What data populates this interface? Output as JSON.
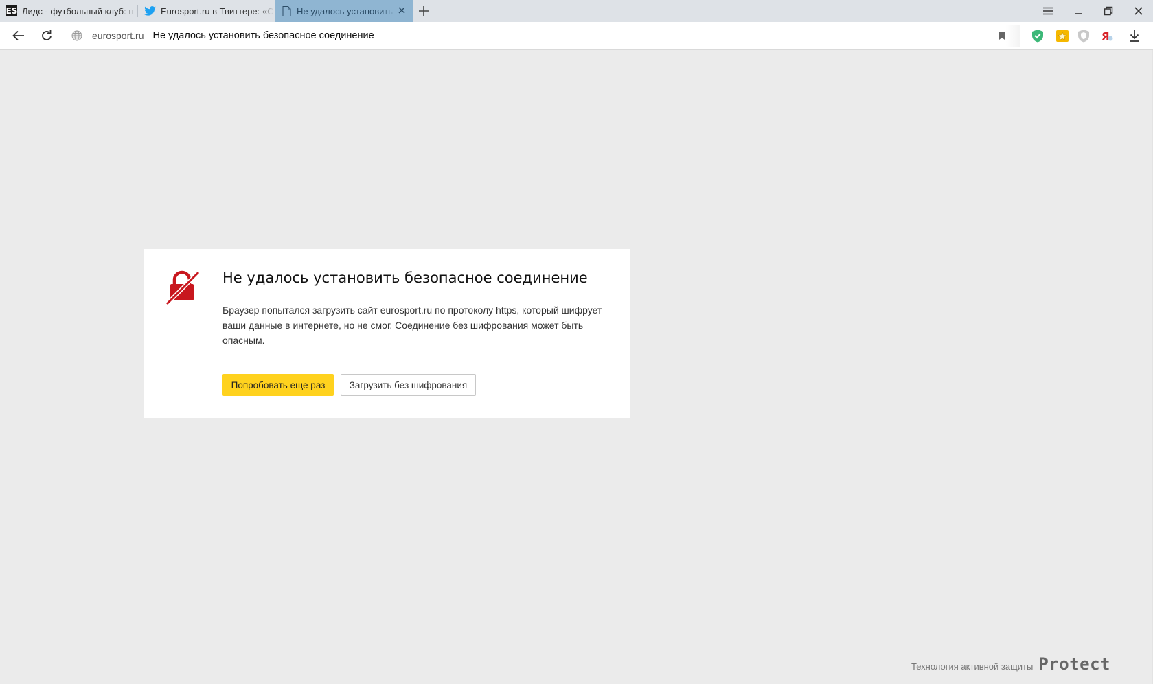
{
  "tabs": [
    {
      "title": "Лидс - футбольный клуб: н",
      "favicon": "eurosport-favicon",
      "favicon_text": "ES",
      "active": false
    },
    {
      "title": "Eurosport.ru в Твиттере: «С",
      "favicon": "twitter-icon",
      "active": false
    },
    {
      "title": "Не удалось установить",
      "favicon": "document-icon",
      "active": true
    }
  ],
  "address_bar": {
    "domain": "eurosport.ru",
    "page_title": "Не удалось установить безопасное соединение"
  },
  "error": {
    "title": "Не удалось установить безопасное соединение",
    "description": "Браузер попытался загрузить сайт eurosport.ru по протоколу https, который шифрует ваши данные в интернете, но не смог. Соединение без шифрования может быть опасным.",
    "retry_label": "Попробовать еще раз",
    "load_unencrypted_label": "Загрузить без шифрования"
  },
  "footer": {
    "caption": "Технология активной защиты",
    "logo_text": "Protect"
  },
  "colors": {
    "accent_yellow": "#ffd21e",
    "active_tab": "#8fb5d2",
    "error_red": "#d0021b",
    "page_background": "#ebebeb"
  }
}
